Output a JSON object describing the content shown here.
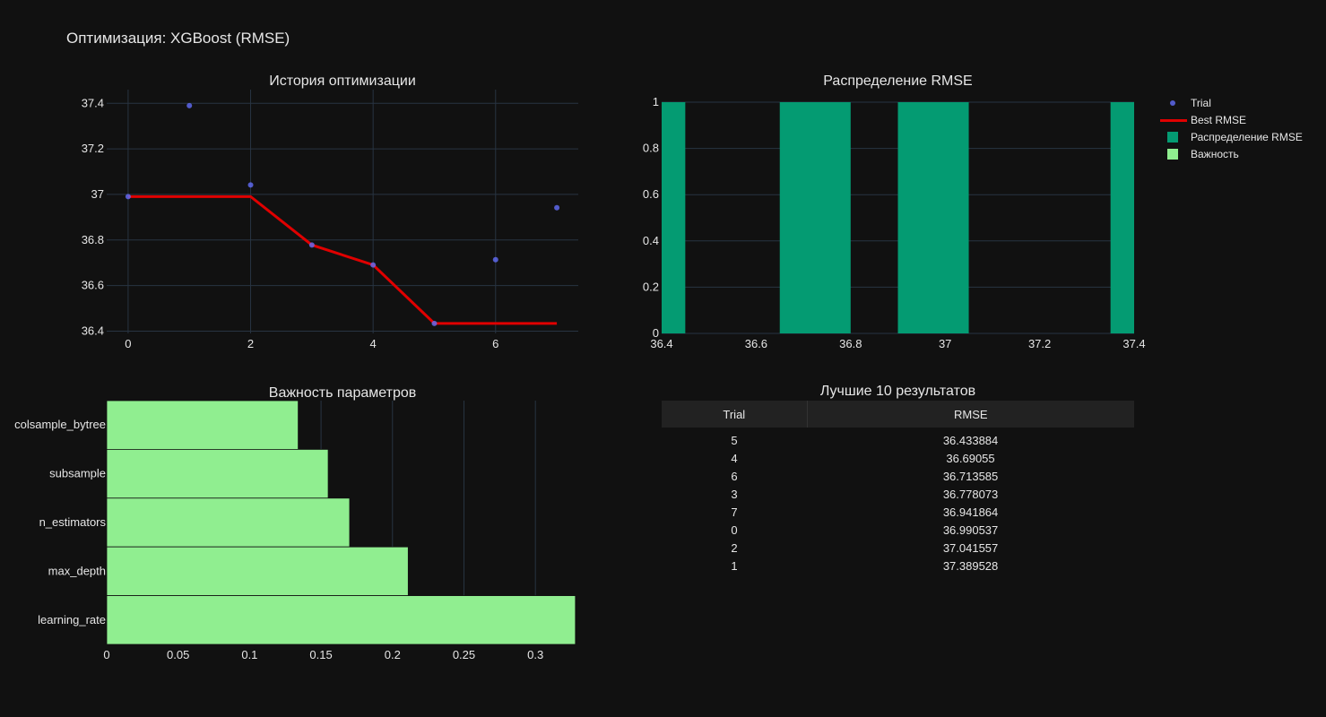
{
  "title": "Оптимизация: XGBoost (RMSE)",
  "colors": {
    "background": "#111111",
    "grid": "#283442",
    "trial_marker": "#636efa",
    "best_line": "#e00000",
    "hist_bar": "#049b72",
    "importance_bar": "#90ee90"
  },
  "legend": [
    {
      "label": "Trial",
      "symbol": "dot",
      "color": "#636efa"
    },
    {
      "label": "Best RMSE",
      "symbol": "line",
      "color": "#e00000"
    },
    {
      "label": "Распределение RMSE",
      "symbol": "box",
      "color": "#049b72"
    },
    {
      "label": "Важность",
      "symbol": "box",
      "color": "#90ee90"
    }
  ],
  "chart_data": [
    {
      "type": "scatter",
      "title": "История оптимизации",
      "xlim": [
        -0.35,
        7.35
      ],
      "ylim": [
        36.39,
        37.46
      ],
      "xticks": [
        0,
        2,
        4,
        6
      ],
      "yticks": [
        36.4,
        36.6,
        36.8,
        37,
        37.2,
        37.4
      ],
      "series": [
        {
          "name": "Trial",
          "mode": "markers",
          "x": [
            0,
            1,
            2,
            3,
            4,
            5,
            6,
            7
          ],
          "y": [
            36.990537,
            37.389528,
            37.041557,
            36.778073,
            36.69055,
            36.433884,
            36.713585,
            36.941864
          ]
        },
        {
          "name": "Best RMSE",
          "mode": "line",
          "x": [
            0,
            1,
            2,
            3,
            4,
            5,
            6,
            7
          ],
          "y": [
            36.990537,
            36.990537,
            36.990537,
            36.778073,
            36.69055,
            36.433884,
            36.433884,
            36.433884
          ]
        }
      ]
    },
    {
      "type": "bar",
      "title": "Распределение RMSE",
      "xlim": [
        36.4,
        37.4
      ],
      "ylim": [
        0,
        1
      ],
      "xticks": [
        36.4,
        36.6,
        36.8,
        37,
        37.2,
        37.4
      ],
      "yticks": [
        0,
        0.2,
        0.4,
        0.6,
        0.8,
        1
      ],
      "bins": [
        {
          "x0": 36.4,
          "x1": 36.45,
          "count": 1
        },
        {
          "x0": 36.65,
          "x1": 36.8,
          "count": 1
        },
        {
          "x0": 36.9,
          "x1": 37.05,
          "count": 1
        },
        {
          "x0": 37.35,
          "x1": 37.4,
          "count": 1
        }
      ]
    },
    {
      "type": "bar",
      "orientation": "horizontal",
      "title": "Важность параметров",
      "xlim": [
        0,
        0.33
      ],
      "xticks": [
        0,
        0.05,
        0.1,
        0.15,
        0.2,
        0.25,
        0.3
      ],
      "categories": [
        "colsample_bytree",
        "subsample",
        "n_estimators",
        "max_depth",
        "learning_rate"
      ],
      "values": [
        0.134,
        0.155,
        0.17,
        0.211,
        0.328
      ]
    }
  ],
  "table": {
    "title": "Лучшие 10 результатов",
    "columns": [
      "Trial",
      "RMSE"
    ],
    "rows": [
      [
        "5",
        "36.433884"
      ],
      [
        "4",
        "36.69055"
      ],
      [
        "6",
        "36.713585"
      ],
      [
        "3",
        "36.778073"
      ],
      [
        "7",
        "36.941864"
      ],
      [
        "0",
        "36.990537"
      ],
      [
        "2",
        "37.041557"
      ],
      [
        "1",
        "37.389528"
      ]
    ]
  }
}
